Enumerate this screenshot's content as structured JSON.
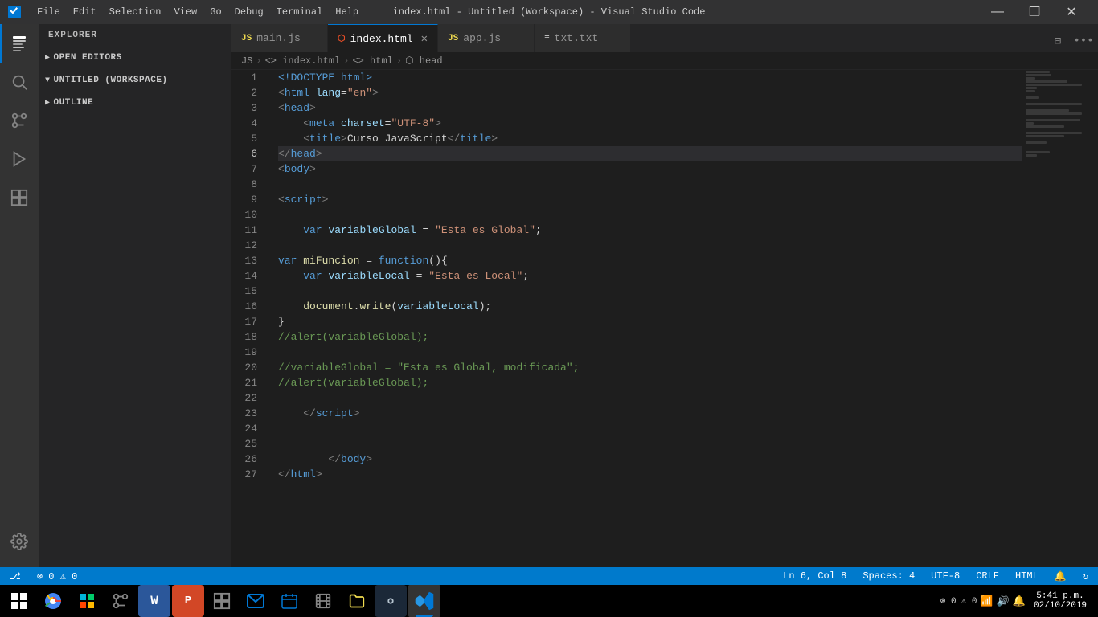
{
  "titlebar": {
    "menu_items": [
      "File",
      "Edit",
      "Selection",
      "View",
      "Go",
      "Debug",
      "Terminal",
      "Help"
    ],
    "title": "index.html - Untitled (Workspace) - Visual Studio Code",
    "minimize": "—",
    "maximize": "❐",
    "close": "✕"
  },
  "activity_bar": {
    "icons": [
      {
        "name": "explorer-icon",
        "symbol": "📄",
        "active": true
      },
      {
        "name": "search-icon",
        "symbol": "🔍",
        "active": false
      },
      {
        "name": "source-control-icon",
        "symbol": "⑂",
        "active": false
      },
      {
        "name": "debug-icon",
        "symbol": "🐛",
        "active": false
      },
      {
        "name": "extensions-icon",
        "symbol": "⊞",
        "active": false
      }
    ]
  },
  "sidebar": {
    "header": "Explorer",
    "sections": [
      {
        "name": "open-editors",
        "label": "Open Editors",
        "expanded": false
      },
      {
        "name": "workspace",
        "label": "Untitled (Workspace)",
        "expanded": true,
        "items": []
      },
      {
        "name": "outline",
        "label": "Outline",
        "expanded": false
      }
    ]
  },
  "tabs": [
    {
      "id": "main-js",
      "label": "main.js",
      "type": "js",
      "active": false
    },
    {
      "id": "index-html",
      "label": "index.html",
      "type": "html",
      "active": true
    },
    {
      "id": "app-js",
      "label": "app.js",
      "type": "js",
      "active": false
    },
    {
      "id": "txt-txt",
      "label": "txt.txt",
      "type": "txt",
      "active": false
    }
  ],
  "breadcrumb": {
    "items": [
      "JS",
      "<> index.html",
      "<> html",
      "⬡ head"
    ]
  },
  "code": {
    "lines": [
      {
        "num": 1,
        "tokens": [
          {
            "t": "doctype",
            "v": "<!DOCTYPE "
          },
          {
            "t": "tagname",
            "v": "html"
          },
          {
            "t": "doctype",
            "v": ">"
          }
        ]
      },
      {
        "num": 2,
        "tokens": [
          {
            "t": "tag",
            "v": "<"
          },
          {
            "t": "tagname",
            "v": "html"
          },
          {
            "t": "attr",
            "v": " lang"
          },
          {
            "t": "equals",
            "v": "="
          },
          {
            "t": "attrval",
            "v": "\"en\""
          },
          {
            "t": "tag",
            "v": ">"
          }
        ]
      },
      {
        "num": 3,
        "tokens": [
          {
            "t": "tag",
            "v": "<"
          },
          {
            "t": "tagname",
            "v": "head"
          },
          {
            "t": "tag",
            "v": ">"
          }
        ]
      },
      {
        "num": 4,
        "tokens": [
          {
            "t": "tag",
            "v": "    <"
          },
          {
            "t": "tagname",
            "v": "meta"
          },
          {
            "t": "attr",
            "v": " charset"
          },
          {
            "t": "equals",
            "v": "="
          },
          {
            "t": "attrval",
            "v": "\"UTF-8\""
          },
          {
            "t": "tag",
            "v": ">"
          }
        ]
      },
      {
        "num": 5,
        "tokens": [
          {
            "t": "tag",
            "v": "    <"
          },
          {
            "t": "tagname",
            "v": "title"
          },
          {
            "t": "tag",
            "v": ">"
          },
          {
            "t": "punct",
            "v": "Curso JavaScript"
          },
          {
            "t": "tag",
            "v": "</"
          },
          {
            "t": "tagname",
            "v": "title"
          },
          {
            "t": "tag",
            "v": ">"
          }
        ]
      },
      {
        "num": 6,
        "tokens": [
          {
            "t": "tag",
            "v": "</"
          },
          {
            "t": "tagname",
            "v": "head"
          },
          {
            "t": "tag",
            "v": ">"
          }
        ],
        "active": true
      },
      {
        "num": 7,
        "tokens": [
          {
            "t": "tag",
            "v": "<"
          },
          {
            "t": "tagname",
            "v": "body"
          },
          {
            "t": "tag",
            "v": ">"
          }
        ]
      },
      {
        "num": 8,
        "tokens": []
      },
      {
        "num": 9,
        "tokens": [
          {
            "t": "tag",
            "v": "<"
          },
          {
            "t": "tagname",
            "v": "script"
          },
          {
            "t": "tag",
            "v": ">"
          }
        ]
      },
      {
        "num": 10,
        "tokens": []
      },
      {
        "num": 11,
        "tokens": [
          {
            "t": "punct",
            "v": "    "
          },
          {
            "t": "kw",
            "v": "var"
          },
          {
            "t": "punct",
            "v": " "
          },
          {
            "t": "var",
            "v": "variableGlobal"
          },
          {
            "t": "punct",
            "v": " = "
          },
          {
            "t": "str",
            "v": "\"Esta es Global\""
          },
          {
            "t": "punct",
            "v": ";"
          }
        ]
      },
      {
        "num": 12,
        "tokens": []
      },
      {
        "num": 13,
        "tokens": [
          {
            "t": "kw",
            "v": "var"
          },
          {
            "t": "punct",
            "v": " "
          },
          {
            "t": "fn",
            "v": "miFuncion"
          },
          {
            "t": "punct",
            "v": " = "
          },
          {
            "t": "kw",
            "v": "function"
          },
          {
            "t": "punct",
            "v": "(){"
          }
        ]
      },
      {
        "num": 14,
        "tokens": [
          {
            "t": "punct",
            "v": "    "
          },
          {
            "t": "kw",
            "v": "var"
          },
          {
            "t": "punct",
            "v": " "
          },
          {
            "t": "var",
            "v": "variableLocal"
          },
          {
            "t": "punct",
            "v": " = "
          },
          {
            "t": "str",
            "v": "\"Esta es Local\""
          },
          {
            "t": "punct",
            "v": ";"
          }
        ]
      },
      {
        "num": 15,
        "tokens": []
      },
      {
        "num": 16,
        "tokens": [
          {
            "t": "punct",
            "v": "    "
          },
          {
            "t": "fn",
            "v": "document"
          },
          {
            "t": "punct",
            "v": "."
          },
          {
            "t": "fn",
            "v": "write"
          },
          {
            "t": "punct",
            "v": "("
          },
          {
            "t": "var",
            "v": "variableLocal"
          },
          {
            "t": "punct",
            "v": ");"
          }
        ]
      },
      {
        "num": 17,
        "tokens": [
          {
            "t": "punct",
            "v": "}"
          }
        ]
      },
      {
        "num": 18,
        "tokens": [
          {
            "t": "comment",
            "v": "//alert(variableGlobal);"
          }
        ]
      },
      {
        "num": 19,
        "tokens": []
      },
      {
        "num": 20,
        "tokens": [
          {
            "t": "comment",
            "v": "//variableGlobal = \"Esta es Global, modificada\";"
          }
        ]
      },
      {
        "num": 21,
        "tokens": [
          {
            "t": "comment",
            "v": "//alert(variableGlobal);"
          }
        ]
      },
      {
        "num": 22,
        "tokens": []
      },
      {
        "num": 23,
        "tokens": [
          {
            "t": "punct",
            "v": "    "
          },
          {
            "t": "tag",
            "v": "</"
          },
          {
            "t": "tagname",
            "v": "script"
          },
          {
            "t": "tag",
            "v": ">"
          }
        ]
      },
      {
        "num": 24,
        "tokens": []
      },
      {
        "num": 25,
        "tokens": []
      },
      {
        "num": 26,
        "tokens": [
          {
            "t": "punct",
            "v": "        "
          },
          {
            "t": "tag",
            "v": "</"
          },
          {
            "t": "tagname",
            "v": "body"
          },
          {
            "t": "tag",
            "v": ">"
          }
        ]
      },
      {
        "num": 27,
        "tokens": [
          {
            "t": "tag",
            "v": "</"
          },
          {
            "t": "tagname",
            "v": "html"
          },
          {
            "t": "tag",
            "v": ">"
          }
        ]
      }
    ]
  },
  "status_bar": {
    "left": [
      {
        "id": "branch",
        "text": ""
      },
      {
        "id": "errors",
        "text": "⊗ 0  ⚠ 0"
      }
    ],
    "right": [
      {
        "id": "ln-col",
        "text": "Ln 6, Col 8"
      },
      {
        "id": "spaces",
        "text": "Spaces: 4"
      },
      {
        "id": "encoding",
        "text": "UTF-8"
      },
      {
        "id": "line-ending",
        "text": "CRLF"
      },
      {
        "id": "language",
        "text": "HTML"
      },
      {
        "id": "bell",
        "text": "🔔"
      },
      {
        "id": "sync",
        "text": "↻"
      }
    ]
  },
  "taskbar": {
    "time": "5:41 p.m.",
    "date": "02/10/2019",
    "apps": [
      {
        "name": "start-button",
        "symbol": "⊞",
        "active": false
      },
      {
        "name": "chrome-icon",
        "symbol": "◎",
        "active": false,
        "color": "#4285f4"
      },
      {
        "name": "store-icon",
        "symbol": "🛍",
        "active": false
      },
      {
        "name": "source-control-taskbar",
        "symbol": "⑂",
        "active": false
      },
      {
        "name": "word-icon",
        "symbol": "W",
        "active": false,
        "color": "#2b579a"
      },
      {
        "name": "powerpoint-icon",
        "symbol": "P",
        "active": false,
        "color": "#d24726"
      },
      {
        "name": "extensions-taskbar",
        "symbol": "⊞",
        "active": false
      },
      {
        "name": "mail-icon",
        "symbol": "✉",
        "active": false
      },
      {
        "name": "calendar-icon",
        "symbol": "📅",
        "active": false
      },
      {
        "name": "film-icon",
        "symbol": "🎬",
        "active": false
      },
      {
        "name": "files-icon",
        "symbol": "📁",
        "active": false
      },
      {
        "name": "steam-icon",
        "symbol": "🎮",
        "active": false
      },
      {
        "name": "vscode-taskbar",
        "symbol": "⬡",
        "active": true,
        "color": "#0078d4"
      }
    ],
    "system_icons": [
      {
        "name": "error-badge",
        "text": "⊗ 0"
      },
      {
        "name": "warning-badge",
        "text": "⚠ 0"
      },
      {
        "name": "notification-icon",
        "text": "🔔"
      },
      {
        "name": "volume-icon",
        "text": "🔊"
      },
      {
        "name": "network-icon",
        "text": "📶"
      }
    ]
  }
}
